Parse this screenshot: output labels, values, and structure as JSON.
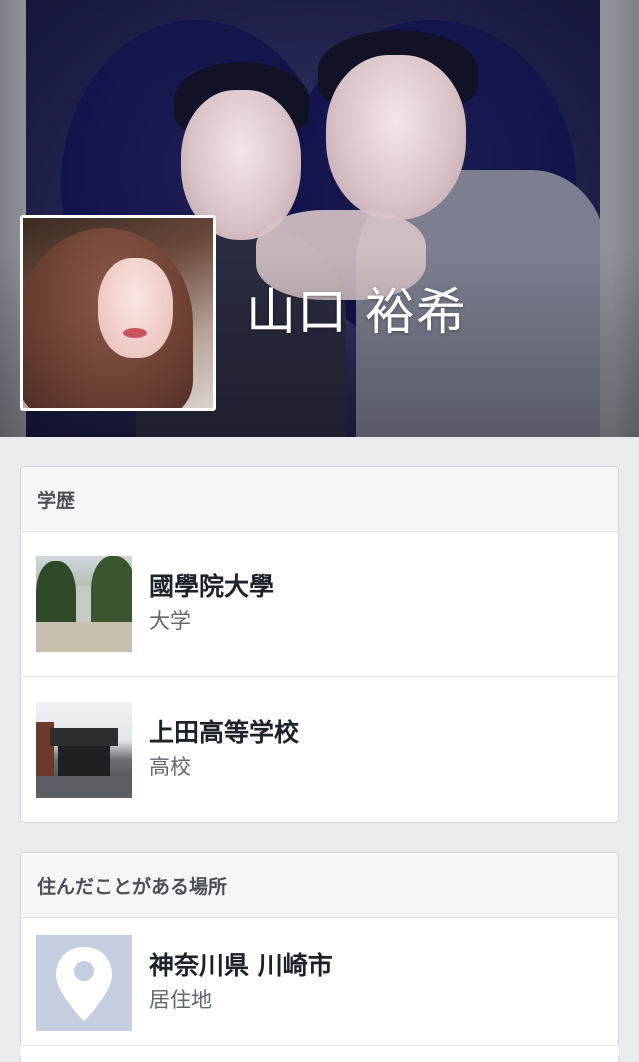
{
  "profile": {
    "name": "山口 裕希"
  },
  "education": {
    "heading": "学歴",
    "items": [
      {
        "title": "國學院大學",
        "subtitle": "大学"
      },
      {
        "title": "上田高等学校",
        "subtitle": "高校"
      }
    ]
  },
  "places": {
    "heading": "住んだことがある場所",
    "items": [
      {
        "title": "神奈川県 川崎市",
        "subtitle": "居住地"
      }
    ]
  },
  "icons": {
    "place_thumbnail": "map-pin-icon"
  },
  "colors": {
    "background": "#e9ebee",
    "card_header": "#f5f6f7",
    "place_thumbnail_bg": "#c5cee0"
  }
}
